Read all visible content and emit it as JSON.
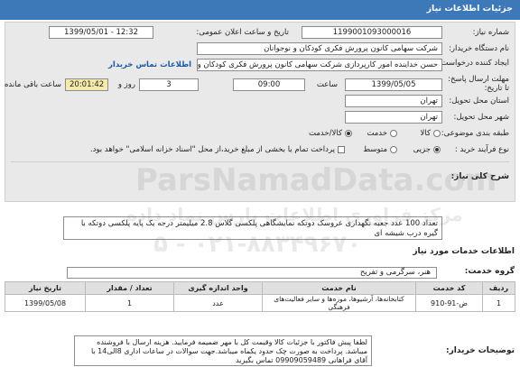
{
  "header": {
    "title": "جزئیات اطلاعات نیاز"
  },
  "form": {
    "need_number_label": "شماره نیاز:",
    "need_number": "1199001093000016",
    "announce_label": "تاریخ و ساعت اعلان عمومی:",
    "announce_value": "1399/05/01 - 12:32",
    "buyer_label": "نام دستگاه خریدار:",
    "buyer_value": "شرکت سهامی کانون پرورش فکری کودکان و نوجوانان",
    "creator_label": "ایجاد کننده درخواست:",
    "creator_value": "حسن خداینده امور کارپردازی  شرکت سهامی کانون پرورش فکری کودکان و نوجوانان",
    "contact_link": "اطلاعات تماس خریدار",
    "deadline_label": "مهلت ارسال پاسخ: تا تاریخ:",
    "deadline_date": "1399/05/05",
    "time_label": "ساعت",
    "deadline_time": "09:00",
    "day_label": "روز و",
    "days_value": "3",
    "remaining_value": "20:01:42",
    "remaining_label": "ساعت باقی مانده",
    "province_label": "استان محل تحویل:",
    "province_value": "تهران",
    "city_label": "شهر محل تحویل:",
    "city_value": "تهران",
    "category_label": "طبقه بندی موضوعی:",
    "category_options": [
      "کالا",
      "خدمت",
      "کالا/خدمت"
    ],
    "category_selected": 2,
    "process_label": "نوع فرآیند خرید :",
    "process_options": [
      "جزیی",
      "متوسط"
    ],
    "process_selected": 0,
    "payment_note": "پرداخت تمام یا بخشی از مبلغ خرید،از محل \"اسناد خزانه اسلامی\" خواهد بود."
  },
  "summary": {
    "label": "شرح کلی نیاز:",
    "text": "تعداد 100 عدد جعبه نگهداری عروسک دوتکه نمایشگاهی پلکسی گلاس 2.8 میلیمتر درجه یک پایه پلکسی دوتکه با گیره درب شیشه ای"
  },
  "services": {
    "section_title": "اطلاعات خدمات مورد نیاز",
    "group_label": "گروه خدمت:",
    "group_value": "هنر، سرگرمی و تفریح",
    "columns": [
      "ردیف",
      "کد خدمت",
      "نام خدمت",
      "واحد اندازه گیری",
      "تعداد / مقدار",
      "تاریخ نیاز"
    ],
    "rows": [
      [
        "1",
        "ض-91-910",
        "کتابخانه‌ها، آرشیوها، موزه‌ها و سایر فعالیت‌های فرهنگی",
        "عدد",
        "1",
        "1399/05/08"
      ]
    ]
  },
  "buyer_notes": {
    "label": "توضیحات خریدار:",
    "text": "لطفا پیش فاکتور با جزئیات کالا وقیمت کل با مهر ضمیمه فرمایید. هزینه ارسال با فروشنده میباشد. پرداخت به صورت چک حدود یکماه میباشد.جهت سوالات در ساعات اداری 8الی14 با آقای فراهانی 09909059489 تماس بگیرید"
  },
  "watermark": {
    "line1": "ParsNamadData.com",
    "line2": "مرکز فراوری اطلاعات پارس نماد داده",
    "line3": "۰۲۱-۸۸۳۴۹۶۷۰ - ۵"
  }
}
